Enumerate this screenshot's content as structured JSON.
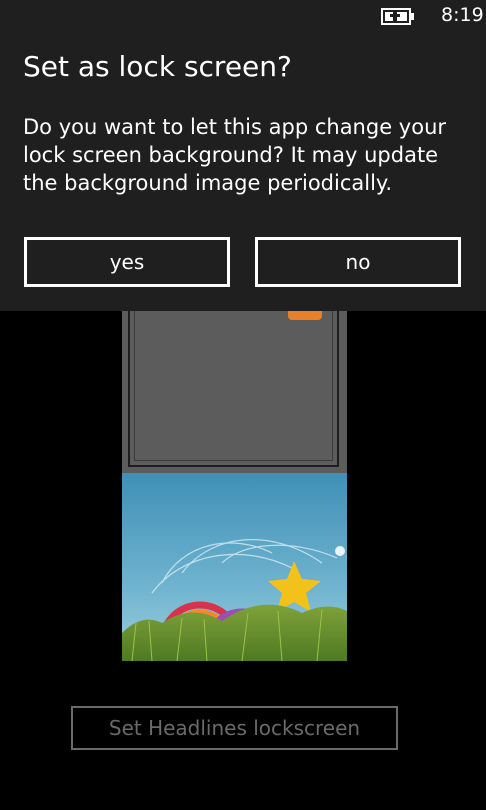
{
  "status_bar": {
    "battery_icon": "battery-charging-icon",
    "time": "8:19"
  },
  "dialog": {
    "title": "Set as lock screen?",
    "message": "Do you want to let this app change your lock screen background? It may update the background image periodically.",
    "yes_label": "yes",
    "no_label": "no"
  },
  "main": {
    "set_lockscreen_label": "Set Headlines lockscreen"
  },
  "colors": {
    "dialog_background": "#1f1f1f",
    "page_background": "#000000",
    "disabled_button": "#6a6a6a"
  }
}
